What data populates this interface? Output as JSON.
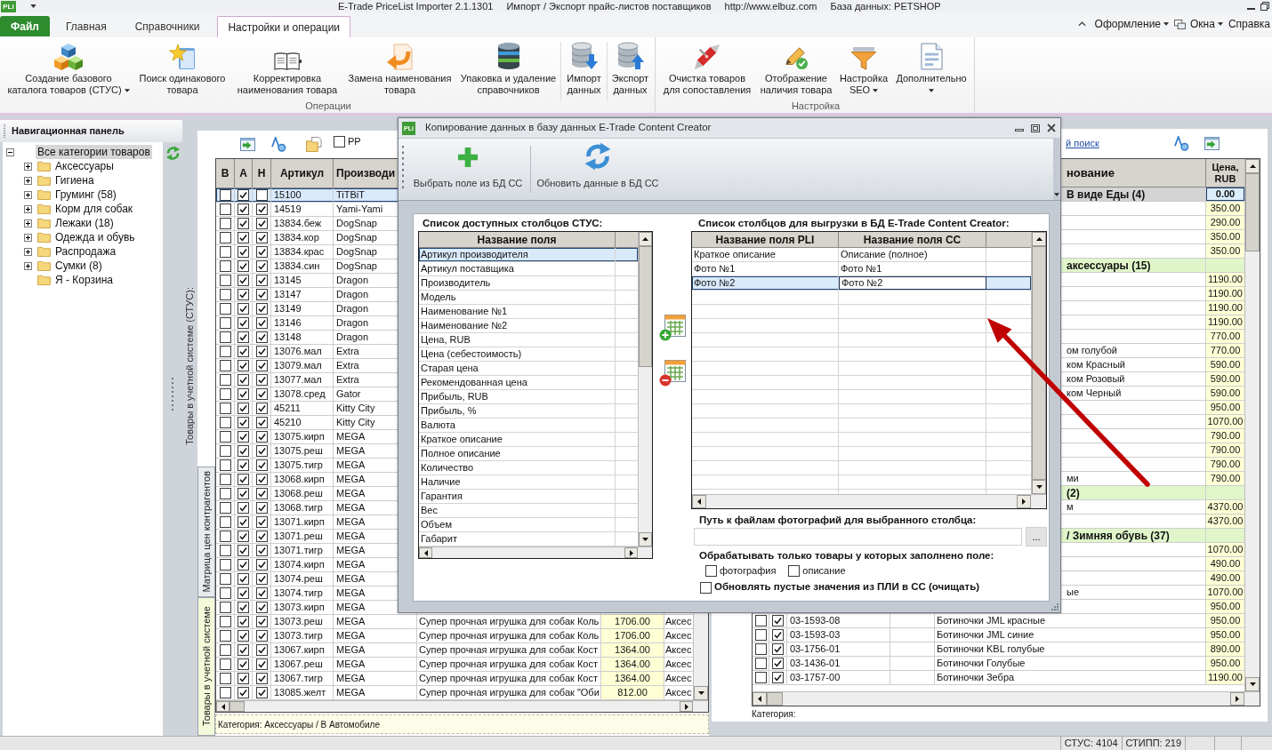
{
  "title_bar": {
    "logo": "PLi",
    "texts": [
      "E-Trade PriceList Importer 2.1.1301",
      "Импорт / Экспорт прайс-листов поставщиков",
      "http://www.elbuz.com",
      "База данных: PETSHOP"
    ]
  },
  "ribbon": {
    "file_button": "Файл",
    "tabs": [
      {
        "label": "Главная",
        "selected": false
      },
      {
        "label": "Справочники",
        "selected": false
      },
      {
        "label": "Настройки и операции",
        "selected": true
      }
    ],
    "menus": [
      {
        "label": "Оформление",
        "dropdown": true
      },
      {
        "label": "Окна",
        "dropdown": true
      },
      {
        "label": "Справка",
        "dropdown": false
      }
    ],
    "groups": [
      {
        "title": "Операции",
        "items": [
          {
            "lines": [
              "Создание базового",
              "каталога товаров (СТУС)"
            ],
            "dropdown": true
          },
          {
            "lines": [
              "Поиск одинакового",
              "товара"
            ],
            "dropdown": false
          },
          {
            "lines": [
              "Корректировка",
              "наименования товара"
            ],
            "dropdown": false
          },
          {
            "lines": [
              "Замена наименования",
              "товара"
            ],
            "dropdown": false
          },
          {
            "lines": [
              "Упаковка и удаление",
              "справочников"
            ],
            "dropdown": false
          },
          {
            "lines": [
              "Импорт",
              "данных"
            ],
            "dropdown": false
          },
          {
            "lines": [
              "Экспорт",
              "данных"
            ],
            "dropdown": false
          }
        ]
      },
      {
        "title": "Настройка",
        "items": [
          {
            "lines": [
              "Очистка товаров",
              "для сопоставления"
            ],
            "dropdown": false
          },
          {
            "lines": [
              "Отображение",
              "наличия товара"
            ],
            "dropdown": false
          },
          {
            "lines": [
              "Настройка",
              "SEO"
            ],
            "dropdown": true
          },
          {
            "lines": [
              "Дополнительно"
            ],
            "dropdown": true
          }
        ]
      }
    ]
  },
  "nav_panel": {
    "title": "Навигационная панель",
    "tree": [
      {
        "label": "Все категории товаров",
        "selected": true,
        "expanded": true,
        "has_children": true,
        "children": [
          {
            "label": "Аксессуары",
            "selected": false,
            "expanded": false,
            "has_children": true
          },
          {
            "label": "Гигиена",
            "selected": false,
            "expanded": false,
            "has_children": true
          },
          {
            "label": "Груминг (58)",
            "selected": false,
            "expanded": false,
            "has_children": true
          },
          {
            "label": "Корм для собак",
            "selected": false,
            "expanded": false,
            "has_children": true
          },
          {
            "label": "Лежаки (18)",
            "selected": false,
            "expanded": false,
            "has_children": true
          },
          {
            "label": "Одежда и обувь",
            "selected": false,
            "expanded": false,
            "has_children": true
          },
          {
            "label": "Распродажа",
            "selected": false,
            "expanded": false,
            "has_children": true
          },
          {
            "label": "Сумки (8)",
            "selected": false,
            "expanded": false,
            "has_children": true
          },
          {
            "label": "Я - Корзина",
            "selected": false,
            "expanded": false,
            "has_children": false
          }
        ]
      }
    ]
  },
  "stus_panel": {
    "caption": "Товары в учетной системе (СТУС):",
    "pp_filter": {
      "label": "PP",
      "checked": false
    },
    "table": {
      "columns": [
        "В",
        "А",
        "Н",
        "Артикул",
        "Производи"
      ],
      "rows": [
        {
          "check_v": false,
          "check_a": true,
          "check_n": false,
          "article": "15100",
          "maker": "TiTBiT",
          "selected": true
        },
        {
          "check_v": false,
          "check_a": true,
          "check_n": true,
          "article": "14519",
          "maker": "Yami-Yami",
          "selected": false
        },
        {
          "check_v": false,
          "check_a": true,
          "check_n": true,
          "article": "13834.беж",
          "maker": "DogSnap",
          "selected": false
        },
        {
          "check_v": false,
          "check_a": true,
          "check_n": true,
          "article": "13834.кор",
          "maker": "DogSnap",
          "selected": false
        },
        {
          "check_v": false,
          "check_a": true,
          "check_n": true,
          "article": "13834.крас",
          "maker": "DogSnap",
          "selected": false
        },
        {
          "check_v": false,
          "check_a": true,
          "check_n": true,
          "article": "13834.син",
          "maker": "DogSnap",
          "selected": false
        },
        {
          "check_v": false,
          "check_a": true,
          "check_n": true,
          "article": "13145",
          "maker": "Dragon",
          "selected": false
        },
        {
          "check_v": false,
          "check_a": true,
          "check_n": true,
          "article": "13147",
          "maker": "Dragon",
          "selected": false
        },
        {
          "check_v": false,
          "check_a": true,
          "check_n": true,
          "article": "13149",
          "maker": "Dragon",
          "selected": false
        },
        {
          "check_v": false,
          "check_a": true,
          "check_n": true,
          "article": "13146",
          "maker": "Dragon",
          "selected": false
        },
        {
          "check_v": false,
          "check_a": true,
          "check_n": true,
          "article": "13148",
          "maker": "Dragon",
          "selected": false
        },
        {
          "check_v": false,
          "check_a": true,
          "check_n": true,
          "article": "13076.мал",
          "maker": "Extra",
          "selected": false
        },
        {
          "check_v": false,
          "check_a": true,
          "check_n": true,
          "article": "13079.мал",
          "maker": "Extra",
          "selected": false
        },
        {
          "check_v": false,
          "check_a": true,
          "check_n": true,
          "article": "13077.мал",
          "maker": "Extra",
          "selected": false
        },
        {
          "check_v": false,
          "check_a": true,
          "check_n": true,
          "article": "13078.сред",
          "maker": "Gator",
          "selected": false
        },
        {
          "check_v": false,
          "check_a": true,
          "check_n": true,
          "article": "45211",
          "maker": "Kitty City",
          "selected": false
        },
        {
          "check_v": false,
          "check_a": true,
          "check_n": true,
          "article": "45210",
          "maker": "Kitty City",
          "selected": false
        },
        {
          "check_v": false,
          "check_a": true,
          "check_n": true,
          "article": "13075.кирп",
          "maker": "MEGA",
          "selected": false
        },
        {
          "check_v": false,
          "check_a": true,
          "check_n": true,
          "article": "13075.реш",
          "maker": "MEGA",
          "selected": false
        },
        {
          "check_v": false,
          "check_a": true,
          "check_n": true,
          "article": "13075.тигр",
          "maker": "MEGA",
          "selected": false
        },
        {
          "check_v": false,
          "check_a": true,
          "check_n": true,
          "article": "13068.кирп",
          "maker": "MEGA",
          "selected": false
        },
        {
          "check_v": false,
          "check_a": true,
          "check_n": true,
          "article": "13068.реш",
          "maker": "MEGA",
          "selected": false
        },
        {
          "check_v": false,
          "check_a": true,
          "check_n": true,
          "article": "13068.тигр",
          "maker": "MEGA",
          "selected": false
        },
        {
          "check_v": false,
          "check_a": true,
          "check_n": true,
          "article": "13071.кирп",
          "maker": "MEGA",
          "selected": false
        },
        {
          "check_v": false,
          "check_a": true,
          "check_n": true,
          "article": "13071.реш",
          "maker": "MEGA",
          "selected": false
        },
        {
          "check_v": false,
          "check_a": true,
          "check_n": true,
          "article": "13071.тигр",
          "maker": "MEGA",
          "selected": false
        },
        {
          "check_v": false,
          "check_a": true,
          "check_n": true,
          "article": "13074.кирп",
          "maker": "MEGA",
          "selected": false
        },
        {
          "check_v": false,
          "check_a": true,
          "check_n": true,
          "article": "13074.реш",
          "maker": "MEGA",
          "selected": false
        },
        {
          "check_v": false,
          "check_a": true,
          "check_n": true,
          "article": "13074.тигр",
          "maker": "MEGA",
          "selected": false
        },
        {
          "check_v": false,
          "check_a": true,
          "check_n": true,
          "article": "13073.кирп",
          "maker": "MEGA",
          "selected": false
        },
        {
          "check_v": false,
          "check_a": true,
          "check_n": true,
          "article": "13073.реш",
          "maker": "MEGA",
          "description": "Супер прочная игрушка для собак Коль",
          "price": "1706.00",
          "category": "Аксес",
          "selected": false
        },
        {
          "check_v": false,
          "check_a": true,
          "check_n": true,
          "article": "13073.тигр",
          "maker": "MEGA",
          "description": "Супер прочная игрушка для собак Коль",
          "price": "1706.00",
          "category": "Аксес",
          "selected": false
        },
        {
          "check_v": false,
          "check_a": true,
          "check_n": true,
          "article": "13067.кирп",
          "maker": "MEGA",
          "description": "Супер прочная игрушка для собак Кост",
          "price": "1364.00",
          "category": "Аксес",
          "selected": false
        },
        {
          "check_v": false,
          "check_a": true,
          "check_n": true,
          "article": "13067.реш",
          "maker": "MEGA",
          "description": "Супер прочная игрушка для собак Кост",
          "price": "1364.00",
          "category": "Аксес",
          "selected": false
        },
        {
          "check_v": false,
          "check_a": true,
          "check_n": true,
          "article": "13067.тигр",
          "maker": "MEGA",
          "description": "Супер прочная игрушка для собак Кост",
          "price": "1364.00",
          "category": "Аксес",
          "selected": false
        },
        {
          "check_v": false,
          "check_a": true,
          "check_n": true,
          "article": "13085.желт",
          "maker": "MEGA",
          "description": "Супер прочная игрушка для собак \"Оби",
          "price": "812.00",
          "category": "Аксес",
          "selected": false
        }
      ]
    },
    "category": "Категория: Аксессуары / В Автомобиле",
    "side_tabs": [
      {
        "label": "Матрица цен контрагентов",
        "selected": false
      },
      {
        "label": "Товары в учетной системе",
        "selected": true
      }
    ]
  },
  "stipp_panel": {
    "search_link": "й поиск",
    "table": {
      "columns": [
        "нование",
        "Цена, RUB"
      ],
      "rows": [
        {
          "kind": "group",
          "label": "В виде Еды (4)",
          "price": "0.00",
          "selected": true
        },
        {
          "kind": "item",
          "price": "350.00",
          "selected": false
        },
        {
          "kind": "item",
          "price": "290.00",
          "selected": false
        },
        {
          "kind": "item",
          "price": "350.00",
          "selected": false
        },
        {
          "kind": "item",
          "price": "350.00",
          "selected": false
        },
        {
          "kind": "group",
          "label": "аксессуары (15)",
          "selected": false
        },
        {
          "kind": "item",
          "price": "1190.00",
          "selected": false
        },
        {
          "kind": "item",
          "price": "1190.00",
          "selected": false
        },
        {
          "kind": "item",
          "price": "1190.00",
          "selected": false
        },
        {
          "kind": "item",
          "price": "1190.00",
          "selected": false
        },
        {
          "kind": "item",
          "price": "770.00",
          "selected": false
        },
        {
          "kind": "item",
          "name": "ом голубой",
          "price": "770.00",
          "selected": false
        },
        {
          "kind": "item",
          "name": "ком Красный",
          "price": "590.00",
          "selected": false
        },
        {
          "kind": "item",
          "name": "ком Розовый",
          "price": "590.00",
          "selected": false
        },
        {
          "kind": "item",
          "name": "ком Черный",
          "price": "590.00",
          "selected": false
        },
        {
          "kind": "item",
          "price": "950.00",
          "selected": false
        },
        {
          "kind": "item",
          "price": "1070.00",
          "selected": false
        },
        {
          "kind": "item",
          "price": "790.00",
          "selected": false
        },
        {
          "kind": "item",
          "price": "790.00",
          "selected": false
        },
        {
          "kind": "item",
          "price": "790.00",
          "selected": false
        },
        {
          "kind": "item",
          "name": "ми",
          "price": "790.00",
          "selected": false
        },
        {
          "kind": "group",
          "label": "(2)",
          "selected": false
        },
        {
          "kind": "item",
          "name": "м",
          "price": "4370.00",
          "selected": false
        },
        {
          "kind": "item",
          "price": "4370.00",
          "selected": false
        },
        {
          "kind": "group",
          "label": "/ Зимняя обувь (37)",
          "selected": false
        },
        {
          "kind": "item",
          "price": "1070.00",
          "selected": false
        },
        {
          "kind": "item",
          "price": "490.00",
          "selected": false
        },
        {
          "kind": "item",
          "price": "490.00",
          "selected": false
        },
        {
          "kind": "item",
          "name": "ые",
          "price": "1070.00",
          "selected": false
        },
        {
          "kind": "item",
          "price": "950.00",
          "selected": false
        },
        {
          "kind": "item",
          "check_1": false,
          "check_2": true,
          "article": "03-1593-08",
          "name": "Ботиночки JML красные",
          "price": "950.00",
          "selected": false
        },
        {
          "kind": "item",
          "check_1": false,
          "check_2": true,
          "article": "03-1593-03",
          "name": "Ботиночки JML синие",
          "price": "950.00",
          "selected": false
        },
        {
          "kind": "item",
          "check_1": false,
          "check_2": true,
          "article": "03-1756-01",
          "name": "Ботиночки KBL голубые",
          "price": "890.00",
          "selected": false
        },
        {
          "kind": "item",
          "check_1": false,
          "check_2": true,
          "article": "03-1436-01",
          "name": "Ботиночки Голубые",
          "price": "950.00",
          "selected": false
        },
        {
          "kind": "item",
          "check_1": false,
          "check_2": true,
          "article": "03-1757-00",
          "name": "Ботиночки Зебра",
          "price": "1190.00",
          "selected": false
        }
      ]
    },
    "category": "Категория:"
  },
  "dialog": {
    "logo": "PLi",
    "title": "Копирование данных в базу данных E-Trade Content Creator",
    "toolbar": [
      "Выбрать поле из БД СС",
      "Обновить данные в БД СС"
    ],
    "available": {
      "title": "Список доступных столбцов СТУС:",
      "column": "Название поля",
      "rows": [
        {
          "label": "Артикул производителя",
          "selected": true
        },
        {
          "label": "Артикул поставщика",
          "selected": false
        },
        {
          "label": "Производитель",
          "selected": false
        },
        {
          "label": "Модель",
          "selected": false
        },
        {
          "label": "Наименование №1",
          "selected": false
        },
        {
          "label": "Наименование №2",
          "selected": false
        },
        {
          "label": "Цена, RUB",
          "selected": false
        },
        {
          "label": "Цена (себестоимость)",
          "selected": false
        },
        {
          "label": "Старая цена",
          "selected": false
        },
        {
          "label": "Рекомендованная цена",
          "selected": false
        },
        {
          "label": "Прибыль, RUB",
          "selected": false
        },
        {
          "label": "Прибыль, %",
          "selected": false
        },
        {
          "label": "Валюта",
          "selected": false
        },
        {
          "label": "Краткое описание",
          "selected": false
        },
        {
          "label": "Полное описание",
          "selected": false
        },
        {
          "label": "Количество",
          "selected": false
        },
        {
          "label": "Наличие",
          "selected": false
        },
        {
          "label": "Гарантия",
          "selected": false
        },
        {
          "label": "Вес",
          "selected": false
        },
        {
          "label": "Объем",
          "selected": false
        },
        {
          "label": "Габарит",
          "selected": false
        }
      ]
    },
    "export": {
      "title": "Список столбцов для выгрузки в БД E-Trade Content Creator:",
      "columns": [
        "Название поля PLI",
        "Название поля СС"
      ],
      "rows": [
        {
          "pli": "Краткое описание",
          "cc": "Описание (полное)",
          "selected": false,
          "editing": false
        },
        {
          "pli": "Фото №1",
          "cc": "Фото №1",
          "selected": false,
          "editing": false
        },
        {
          "pli": "Фото №2",
          "cc": "Фото №2",
          "selected": true,
          "editing": true
        }
      ]
    },
    "path": {
      "label": "Путь к файлам фотографий для выбранного столбца:",
      "browse": "..."
    },
    "filter": {
      "label": "Обрабатывать только товары у которых заполнено поле:",
      "options": [
        {
          "label": "фотография",
          "checked": false
        },
        {
          "label": "описание",
          "checked": false
        }
      ]
    },
    "clear_option": {
      "label": "Обновлять пустые значения из ПЛИ в СС (очищать)",
      "checked": false
    }
  },
  "status_bar": {
    "segments": [
      "СТУС: 4104",
      "СТИПП: 219"
    ]
  }
}
